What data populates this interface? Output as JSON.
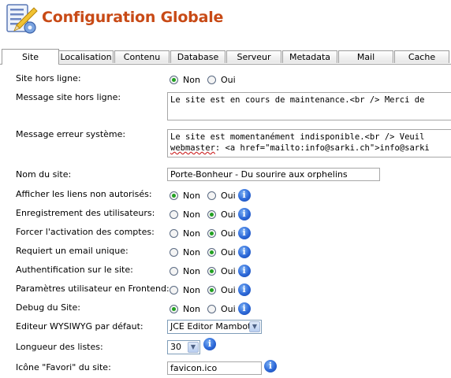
{
  "title": "Configuration Globale",
  "tabs": [
    "Site",
    "Localisation",
    "Contenu",
    "Database",
    "Serveur",
    "Metadata",
    "Mail",
    "Cache"
  ],
  "active_tab": "Site",
  "radio_labels": {
    "no": "Non",
    "yes": "Oui"
  },
  "fields": {
    "offline": {
      "label": "Site hors ligne:",
      "value": "Non"
    },
    "offline_message": {
      "label": "Message site hors ligne:",
      "value": "Le site est en cours de maintenance.<br /> Merci de"
    },
    "error_message": {
      "label": "Message erreur système:",
      "line1": "Le site est momentanément indisponible.<br /> Veuil",
      "line2_prefix": "webmaster",
      "line2_rest": ": <a href=\"mailto:info@sarki.ch\">info@sarki"
    },
    "site_name": {
      "label": "Nom du site:",
      "value": "Porte-Bonheur - Du sourire aux orphelins"
    },
    "show_unauthorized": {
      "label": "Afficher les liens non autorisés:",
      "value": "Non"
    },
    "user_registration": {
      "label": "Enregistrement des utilisateurs:",
      "value": "Oui"
    },
    "force_activation": {
      "label": "Forcer l'activation des comptes:",
      "value": "Oui"
    },
    "unique_email": {
      "label": "Requiert un email unique:",
      "value": "Oui"
    },
    "site_auth": {
      "label": "Authentification sur le site:",
      "value": "Oui"
    },
    "frontend_params": {
      "label": "Paramètres utilisateur en Frontend:",
      "value": "Oui"
    },
    "debug": {
      "label": "Debug du Site:",
      "value": "Non"
    },
    "wysiwyg": {
      "label": "Editeur WYSIWYG par défaut:",
      "value": "JCE Editor Mambot"
    },
    "list_length": {
      "label": "Longueur des listes:",
      "value": "30"
    },
    "favicon": {
      "label": "Icône \"Favori\" du site:",
      "value": "favicon.ico"
    }
  },
  "colors": {
    "title": "#c84a16",
    "radio_checked": "#21a121",
    "info_icon": "#2c68d8"
  },
  "icons": {
    "logo": "config-checklist-icon",
    "info": "info-icon",
    "dropdown": "chevron-down-icon"
  }
}
